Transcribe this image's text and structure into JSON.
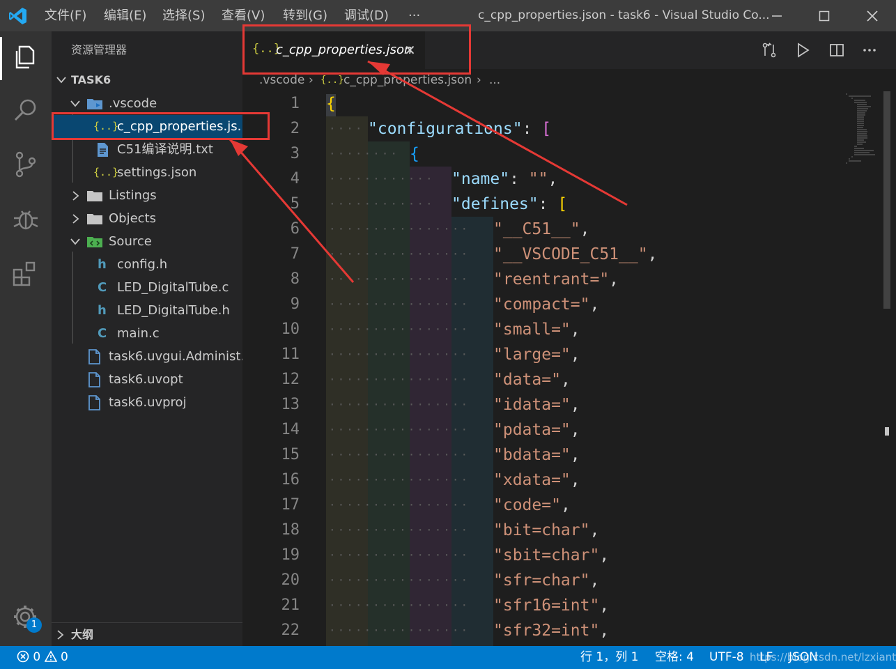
{
  "window": {
    "title": "c_cpp_properties.json - task6 - Visual Studio Co...",
    "menu": [
      "文件(F)",
      "编辑(E)",
      "选择(S)",
      "查看(V)",
      "转到(G)",
      "调试(D)",
      "···"
    ]
  },
  "sidebar": {
    "title": "资源管理器",
    "section": "TASK6",
    "tree": [
      {
        "label": ".vscode",
        "type": "folder-open",
        "icon": "vscode-folder-icon",
        "depth": 1
      },
      {
        "label": "c_cpp_properties.js...",
        "type": "file",
        "icon": "json-icon",
        "depth": 2,
        "selected": true
      },
      {
        "label": "C51编译说明.txt",
        "type": "file",
        "icon": "text-file-icon",
        "depth": 2
      },
      {
        "label": "settings.json",
        "type": "file",
        "icon": "json-icon",
        "depth": 2
      },
      {
        "label": "Listings",
        "type": "folder-closed",
        "icon": "folder-icon",
        "depth": 1
      },
      {
        "label": "Objects",
        "type": "folder-closed",
        "icon": "folder-icon",
        "depth": 1
      },
      {
        "label": "Source",
        "type": "folder-open",
        "icon": "source-folder-icon",
        "depth": 1
      },
      {
        "label": "config.h",
        "type": "file",
        "icon": "c-header-icon",
        "depth": 2
      },
      {
        "label": "LED_DigitalTube.c",
        "type": "file",
        "icon": "c-source-icon",
        "depth": 2
      },
      {
        "label": "LED_DigitalTube.h",
        "type": "file",
        "icon": "c-header-icon",
        "depth": 2
      },
      {
        "label": "main.c",
        "type": "file",
        "icon": "c-source-icon",
        "depth": 2
      },
      {
        "label": "task6.uvgui.Administ...",
        "type": "file",
        "icon": "generic-file-icon",
        "depth": 1
      },
      {
        "label": "task6.uvopt",
        "type": "file",
        "icon": "generic-file-icon",
        "depth": 1
      },
      {
        "label": "task6.uvproj",
        "type": "file",
        "icon": "generic-file-icon",
        "depth": 1
      }
    ],
    "outline": "大纲",
    "settings_badge": "1"
  },
  "editor": {
    "tab": {
      "icon_text": "{..}",
      "label": "c_cpp_properties.json",
      "close": "✕"
    },
    "breadcrumb": {
      "folder": ".vscode",
      "sep": "›",
      "icon_text": "{..}",
      "file": "c_cpp_properties.json",
      "more": "..."
    },
    "line_numbers": [
      "1",
      "2",
      "3",
      "4",
      "5",
      "6",
      "7",
      "8",
      "9",
      "10",
      "11",
      "12",
      "13",
      "14",
      "15",
      "16",
      "17",
      "18",
      "19",
      "20",
      "21",
      "22"
    ],
    "lines": [
      {
        "b": "{"
      },
      {
        "key": "\"configurations\"",
        "p": ": ",
        "b2": "["
      },
      {
        "b3": "{"
      },
      {
        "key": "\"name\"",
        "p": ": ",
        "str": "\"\"",
        "p2": ","
      },
      {
        "key": "\"defines\"",
        "p": ": ",
        "b": "["
      },
      {
        "str": "\"__C51__\"",
        "p2": ","
      },
      {
        "str": "\"__VSCODE_C51__\"",
        "p2": ","
      },
      {
        "str": "\"reentrant=\"",
        "p2": ","
      },
      {
        "str": "\"compact=\"",
        "p2": ","
      },
      {
        "str": "\"small=\"",
        "p2": ","
      },
      {
        "str": "\"large=\"",
        "p2": ","
      },
      {
        "str": "\"data=\"",
        "p2": ","
      },
      {
        "str": "\"idata=\"",
        "p2": ","
      },
      {
        "str": "\"pdata=\"",
        "p2": ","
      },
      {
        "str": "\"bdata=\"",
        "p2": ","
      },
      {
        "str": "\"xdata=\"",
        "p2": ","
      },
      {
        "str": "\"code=\"",
        "p2": ","
      },
      {
        "str": "\"bit=char\"",
        "p2": ","
      },
      {
        "str": "\"sbit=char\"",
        "p2": ","
      },
      {
        "str": "\"sfr=char\"",
        "p2": ","
      },
      {
        "str": "\"sfr16=int\"",
        "p2": ","
      },
      {
        "str": "\"sfr32=int\"",
        "p2": ","
      }
    ]
  },
  "status": {
    "errors": "0",
    "warnings": "0",
    "position": "行 1，列 1",
    "spaces": "空格: 4",
    "encoding": "UTF-8",
    "eol": "LF",
    "language": "JSON",
    "watermark": "https://blog.csdn.net/lzxiantu"
  },
  "colors": {
    "accent": "#007acc",
    "annotation": "#e53935"
  }
}
